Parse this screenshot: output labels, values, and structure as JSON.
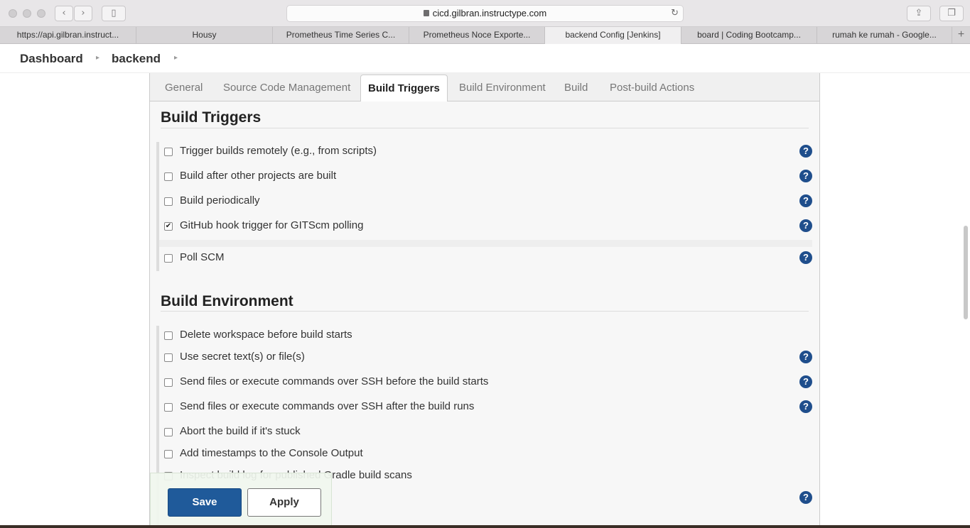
{
  "browser": {
    "url": "cicd.gilbran.instructype.com",
    "tabs": [
      {
        "label": "https://api.gilbran.instruct..."
      },
      {
        "label": "Housy"
      },
      {
        "label": "Prometheus Time Series C..."
      },
      {
        "label": "Prometheus Noce Exporte..."
      },
      {
        "label": "backend Config [Jenkins]"
      },
      {
        "label": "board | Coding Bootcamp..."
      },
      {
        "label": "rumah ke rumah - Google..."
      }
    ]
  },
  "breadcrumb": {
    "dashboard": "Dashboard",
    "project": "backend"
  },
  "config_tabs": [
    {
      "label": "General"
    },
    {
      "label": "Source Code Management"
    },
    {
      "label": "Build Triggers"
    },
    {
      "label": "Build Environment"
    },
    {
      "label": "Build"
    },
    {
      "label": "Post-build Actions"
    }
  ],
  "build_triggers": {
    "title": "Build Triggers",
    "options": [
      {
        "label": "Trigger builds remotely (e.g., from scripts)",
        "checked": false
      },
      {
        "label": "Build after other projects are built",
        "checked": false
      },
      {
        "label": "Build periodically",
        "checked": false
      },
      {
        "label": "GitHub hook trigger for GITScm polling",
        "checked": true
      },
      {
        "label": "Poll SCM",
        "checked": false
      }
    ]
  },
  "build_environment": {
    "title": "Build Environment",
    "options": [
      {
        "label": "Delete workspace before build starts",
        "checked": false
      },
      {
        "label": "Use secret text(s) or file(s)",
        "checked": false
      },
      {
        "label": "Send files or execute commands over SSH before the build starts",
        "checked": false
      },
      {
        "label": "Send files or execute commands over SSH after the build runs",
        "checked": false
      },
      {
        "label": "Abort the build if it's stuck",
        "checked": false
      },
      {
        "label": "Add timestamps to the Console Output",
        "checked": false
      },
      {
        "label": "Inspect build log for published Gradle build scans",
        "checked": false
      }
    ]
  },
  "actions": {
    "save": "Save",
    "apply": "Apply"
  },
  "icons": {
    "help": "?",
    "check": "✔"
  },
  "colors": {
    "save_button": "#1f5a9a",
    "help_icon": "#1f4e8c"
  }
}
